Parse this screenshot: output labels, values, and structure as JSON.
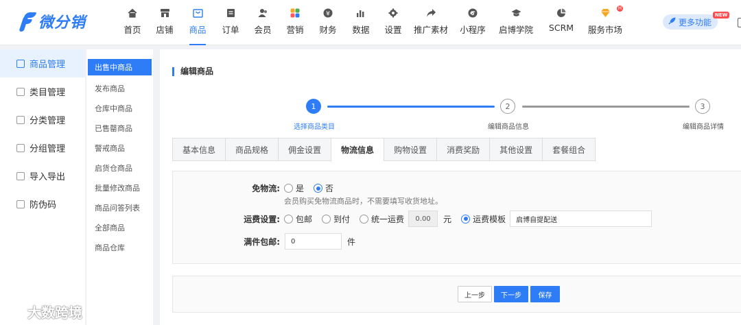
{
  "brand": {
    "name": "微分销",
    "accent": "#2f7df6"
  },
  "nav": {
    "items": [
      {
        "label": "首页",
        "icon": "home-icon"
      },
      {
        "label": "店铺",
        "icon": "shop-icon"
      },
      {
        "label": "商品",
        "icon": "bag-icon",
        "active": true
      },
      {
        "label": "订单",
        "icon": "order-icon"
      },
      {
        "label": "会员",
        "icon": "member-icon"
      },
      {
        "label": "营销",
        "icon": "marketing-icon"
      },
      {
        "label": "财务",
        "icon": "finance-icon"
      },
      {
        "label": "数据",
        "icon": "chart-icon"
      },
      {
        "label": "设置",
        "icon": "gear-icon"
      },
      {
        "label": "推广素材",
        "icon": "share-icon"
      },
      {
        "label": "小程序",
        "icon": "miniapp-icon"
      },
      {
        "label": "启博学院",
        "icon": "academy-icon"
      },
      {
        "label": "SCRM",
        "icon": "pie-icon"
      },
      {
        "label": "服务市场",
        "icon": "diamond-icon",
        "badge": "H"
      }
    ],
    "more_label": "更多功能",
    "new_tag": "NEW"
  },
  "sidebar": {
    "items": [
      {
        "label": "商品管理",
        "active": true
      },
      {
        "label": "类目管理"
      },
      {
        "label": "分类管理"
      },
      {
        "label": "分组管理"
      },
      {
        "label": "导入导出"
      },
      {
        "label": "防伪码"
      }
    ]
  },
  "subnav": {
    "items": [
      {
        "label": "出售中商品",
        "active": true
      },
      {
        "label": "发布商品"
      },
      {
        "label": "仓库中商品"
      },
      {
        "label": "已售罄商品"
      },
      {
        "label": "警戒商品"
      },
      {
        "label": "启货仓商品"
      },
      {
        "label": "批量修改商品"
      },
      {
        "label": "商品问答列表"
      },
      {
        "label": "全部商品"
      },
      {
        "label": "商品仓库"
      }
    ]
  },
  "page": {
    "title": "编辑商品"
  },
  "steps": [
    {
      "num": "1",
      "label": "选择商品类目",
      "done": true
    },
    {
      "num": "2",
      "label": "编辑商品信息",
      "done": false
    },
    {
      "num": "3",
      "label": "编辑商品详情",
      "done": false
    }
  ],
  "tabs": [
    {
      "label": "基本信息"
    },
    {
      "label": "商品规格"
    },
    {
      "label": "佣金设置"
    },
    {
      "label": "物流信息",
      "active": true
    },
    {
      "label": "购物设置"
    },
    {
      "label": "消费奖励"
    },
    {
      "label": "其他设置"
    },
    {
      "label": "套餐组合"
    }
  ],
  "form": {
    "free_shipping": {
      "label": "免物流:",
      "options": [
        "是",
        "否"
      ],
      "selected": "否",
      "hint": "会员购买免物流商品时，不需要填写收货地址。"
    },
    "freight": {
      "label": "运费设置:",
      "options": [
        "包邮",
        "到付",
        "统一运费",
        "运费模板"
      ],
      "selected": "运费模板",
      "unified_value": "0.00",
      "unified_unit": "元",
      "template_value": "启博自提配送"
    },
    "full_free": {
      "label": "满件包邮:",
      "value": "0",
      "unit": "件"
    }
  },
  "actions": {
    "prev": "上一步",
    "next": "下一步",
    "save": "保存"
  },
  "watermark": {
    "text": "大数跨境"
  }
}
